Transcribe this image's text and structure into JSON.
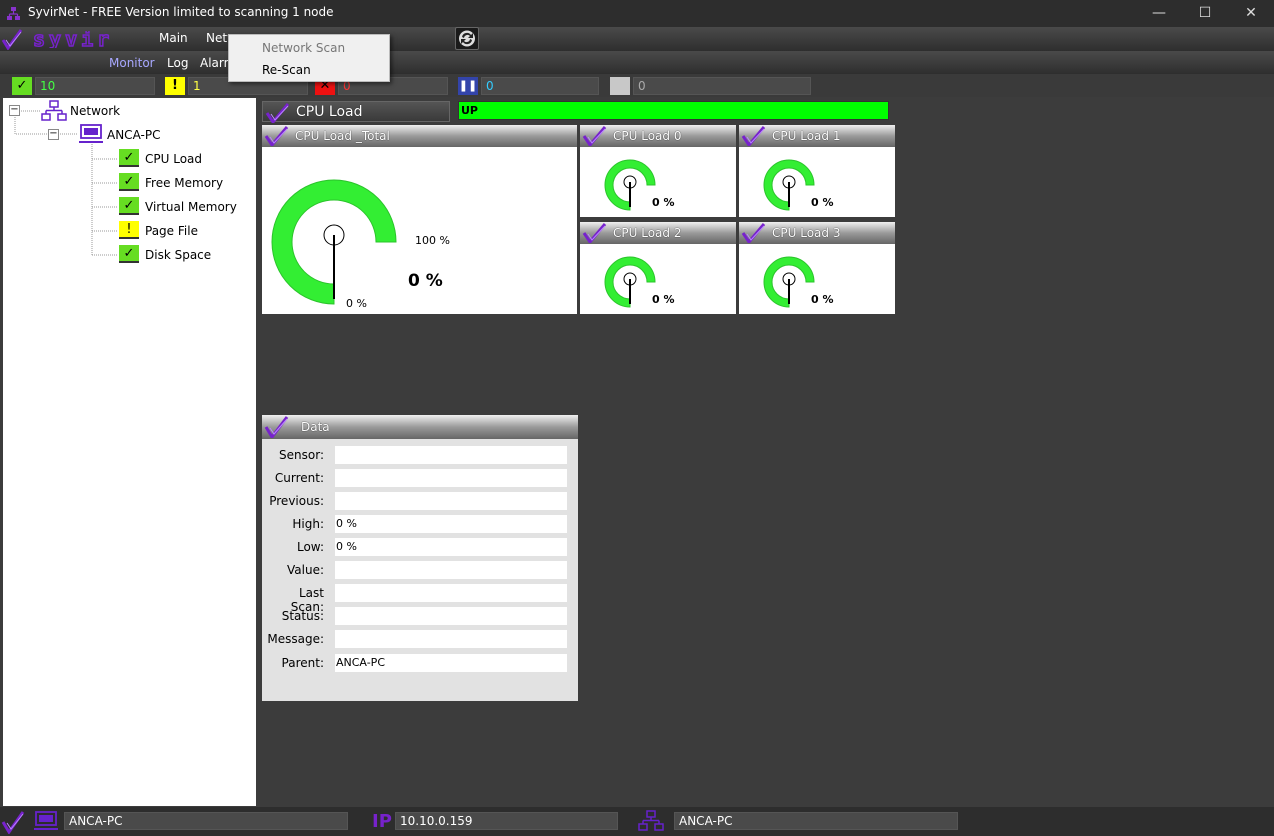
{
  "window": {
    "title": "SyvirNet - FREE Version limited to scanning 1 node",
    "controls": {
      "minimize": "—",
      "maximize": "☐",
      "close": "✕"
    }
  },
  "logo": {
    "text": "syvir"
  },
  "menu": {
    "main": "Main",
    "network": "Netw"
  },
  "submenu": {
    "monitor": "Monitor",
    "log": "Log",
    "alarm": "Alarm"
  },
  "dropdown": {
    "items": [
      "Network Scan",
      "Re-Scan"
    ]
  },
  "counters": {
    "ok": "10",
    "warning": "1",
    "error": "0",
    "paused": "0",
    "unknown": "0"
  },
  "tree": {
    "root": "Network",
    "host": "ANCA-PC",
    "sensors": [
      {
        "label": "CPU Load",
        "status": "ok"
      },
      {
        "label": "Free Memory",
        "status": "ok"
      },
      {
        "label": "Virtual Memory",
        "status": "ok"
      },
      {
        "label": "Page File",
        "status": "warning"
      },
      {
        "label": "Disk Space",
        "status": "ok"
      }
    ]
  },
  "sensor_header": {
    "title": "CPU Load",
    "state": "UP"
  },
  "gauges": {
    "total": {
      "title": "CPU Load _Total",
      "value": "0 %",
      "max_label": "100 %",
      "min_label": "0 %"
    },
    "cores": [
      {
        "title": "CPU Load 0",
        "value": "0 %"
      },
      {
        "title": "CPU Load 1",
        "value": "0 %"
      },
      {
        "title": "CPU Load 2",
        "value": "0 %"
      },
      {
        "title": "CPU Load 3",
        "value": "0 %"
      }
    ]
  },
  "data_panel": {
    "title": "Data",
    "rows": [
      {
        "label": "Sensor:",
        "value": ""
      },
      {
        "label": "Current:",
        "value": ""
      },
      {
        "label": "Previous:",
        "value": ""
      },
      {
        "label": "High:",
        "value": "0 %"
      },
      {
        "label": "Low:",
        "value": "0 %"
      },
      {
        "label": "Value:",
        "value": ""
      },
      {
        "label": "Last Scan:",
        "value": ""
      },
      {
        "label": "Status:",
        "value": ""
      },
      {
        "label": "Message:",
        "value": ""
      },
      {
        "label": "Parent:",
        "value": "ANCA-PC"
      }
    ]
  },
  "bottom": {
    "host": "ANCA-PC",
    "ip_label": "IP",
    "ip": "10.10.0.159",
    "network_host": "ANCA-PC"
  },
  "colors": {
    "accent_purple": "#7722cc",
    "ok_green": "#66dd22",
    "gauge_green": "#33ee33",
    "up_green": "#00ff00",
    "warn_yellow": "#ffff00",
    "error_red": "#ee1111",
    "pause_blue": "#3344aa",
    "counter_ok_text": "#44ff44",
    "counter_warn_text": "#ffff44",
    "counter_error_text": "#ff3333",
    "counter_pause_text": "#33ccff"
  }
}
